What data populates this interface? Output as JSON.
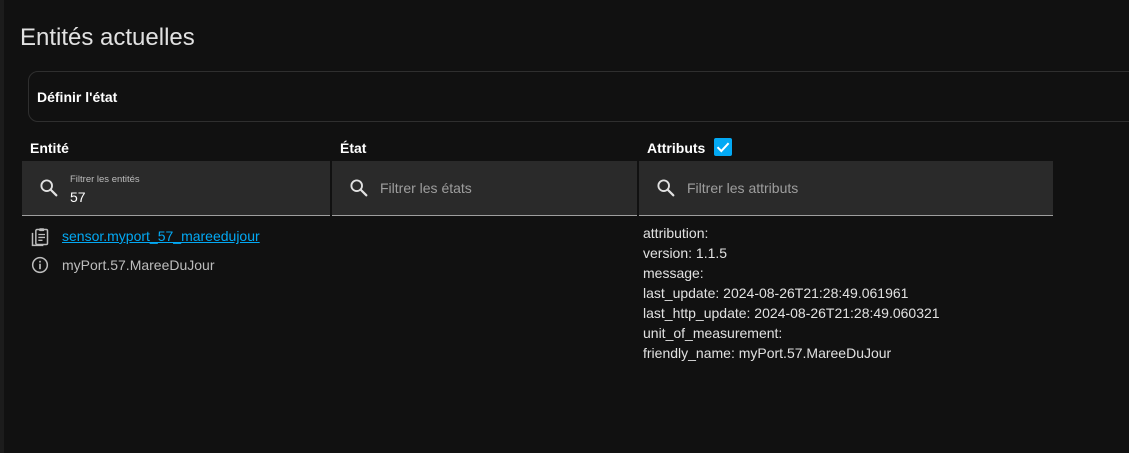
{
  "page": {
    "title": "Entités actuelles"
  },
  "set_state_card": {
    "title": "Définir l'état"
  },
  "columns": {
    "entity": "Entité",
    "state": "État",
    "attributes": "Attributs",
    "attributes_checked": true
  },
  "filters": {
    "entity": {
      "label": "Filtrer les entités",
      "value": "57"
    },
    "state": {
      "placeholder": "Filtrer les états"
    },
    "attributes": {
      "placeholder": "Filtrer les attributs"
    }
  },
  "rows": [
    {
      "entity_id": "sensor.myport_57_mareedujour",
      "friendly_name": "myPort.57.MareeDuJour",
      "state": "",
      "attributes": [
        "attribution:",
        "version: 1.1.5",
        "message:",
        "last_update: 2024-08-26T21:28:49.061961",
        "last_http_update: 2024-08-26T21:28:49.060321",
        "unit_of_measurement:",
        "friendly_name: myPort.57.MareeDuJour"
      ]
    }
  ],
  "icons": {
    "search": "magnify-icon",
    "copy": "clipboard-multiple-icon",
    "info": "information-outline-icon",
    "check": "check-icon"
  },
  "colors": {
    "accent": "#03a9f4",
    "background": "#111111",
    "field": "#2a2a2a"
  }
}
